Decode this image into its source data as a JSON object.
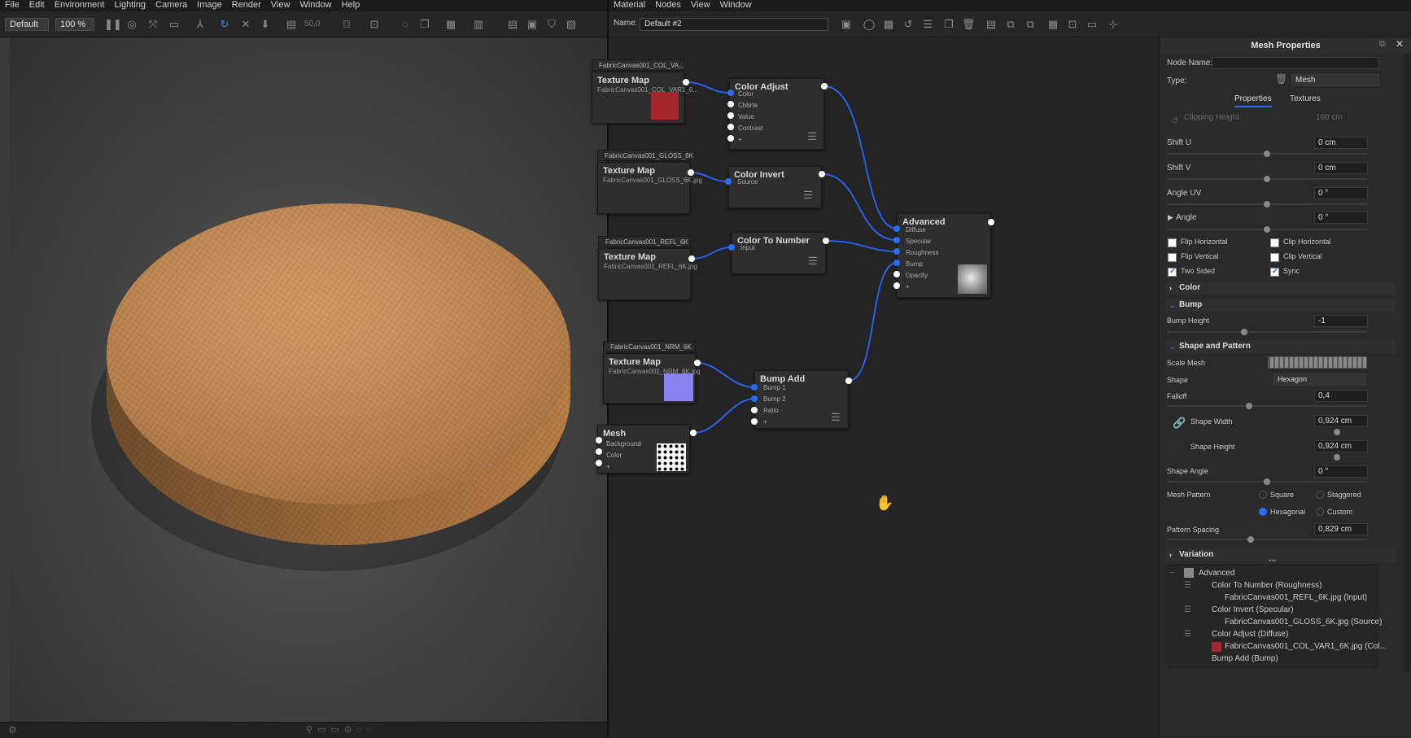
{
  "left_menu": [
    "File",
    "Edit",
    "Environment",
    "Lighting",
    "Camera",
    "Image",
    "Render",
    "View",
    "Window",
    "Help"
  ],
  "left_toolbar": {
    "preset": "Default",
    "zoom": "100 %",
    "resolution_value": "50,0"
  },
  "right_menu": [
    "Material",
    "Nodes",
    "View",
    "Window"
  ],
  "right_toolbar": {
    "name_label": "Name:",
    "name_value": "Default #2"
  },
  "nodes": {
    "col": {
      "header": "FabricCanvas001_COL_VA...",
      "title": "Texture Map",
      "file": "FabricCanvas001_COL_VAR1_6..."
    },
    "gloss": {
      "header": "FabricCanvas001_GLOSS_6K",
      "title": "Texture Map",
      "file": "FabricCanvas001_GLOSS_6K.jpg"
    },
    "refl": {
      "header": "FabricCanvas001_REFL_6K",
      "title": "Texture Map",
      "file": "FabricCanvas001_REFL_6K.jpg"
    },
    "nrm": {
      "header": "FabricCanvas001_NRM_6K",
      "title": "Texture Map",
      "file": "FabricCanvas001_NRM_6K.jpg"
    },
    "color_adjust": {
      "title": "Color Adjust",
      "ports": [
        "Color",
        "Cbbrte",
        "Value",
        "Contrast",
        "+"
      ]
    },
    "color_invert": {
      "title": "Color Invert",
      "ports": [
        "Source"
      ]
    },
    "color_to_number": {
      "title": "Color To Number",
      "ports": [
        "Input"
      ]
    },
    "advanced": {
      "title": "Advanced",
      "ports": [
        "Diffuse",
        "Specular",
        "Roughness",
        "Bump",
        "Opacity",
        "+"
      ]
    },
    "bump_add": {
      "title": "Bump Add",
      "ports": [
        "Bump 1",
        "Bump 2",
        "Ratio",
        "+"
      ]
    },
    "mesh": {
      "title": "Mesh",
      "ports": [
        "Background",
        "Color",
        "+"
      ]
    }
  },
  "properties": {
    "panel_title": "Mesh Properties",
    "node_name_label": "Node Name:",
    "type_label": "Type:",
    "type_value": "Mesh",
    "tabs": [
      "Properties",
      "Textures"
    ],
    "clipping_height_label": "Clipping Height",
    "clipping_height_value": "100 cm",
    "shift_u_label": "Shift U",
    "shift_u_value": "0 cm",
    "shift_v_label": "Shift V",
    "shift_v_value": "0 cm",
    "angle_uv_label": "Angle UV",
    "angle_uv_value": "0 °",
    "angle_label": "Angle",
    "angle_value": "0 °",
    "flip_horizontal": "Flip Horizontal",
    "clip_horizontal": "Clip Horizontal",
    "flip_vertical": "Flip Vertical",
    "clip_vertical": "Clip Vertical",
    "two_sided": "Two Sided",
    "sync": "Sync",
    "section_color": "Color",
    "section_bump": "Bump",
    "bump_height_label": "Bump Height",
    "bump_height_value": "-1",
    "section_shape": "Shape and Pattern",
    "scale_mesh_label": "Scale Mesh",
    "shape_label": "Shape",
    "shape_value": "Hexagon",
    "falloff_label": "Falloff",
    "falloff_value": "0,4",
    "shape_width_label": "Shape Width",
    "shape_width_value": "0,924 cm",
    "shape_height_label": "Shape Height",
    "shape_height_value": "0,924 cm",
    "shape_angle_label": "Shape Angle",
    "shape_angle_value": "0 °",
    "mesh_pattern_label": "Mesh Pattern",
    "pattern_square": "Square",
    "pattern_staggered": "Staggered",
    "pattern_hexagonal": "Hexagonal",
    "pattern_custom": "Custom",
    "pattern_spacing_label": "Pattern Spacing",
    "pattern_spacing_value": "0,829 cm",
    "section_variation": "Variation",
    "tree": [
      "Advanced",
      "Color To Number (Roughness)",
      "FabricCanvas001_REFL_6K.jpg (Input)",
      "Color Invert (Specular)",
      "FabricCanvas001_GLOSS_6K.jpg (Source)",
      "Color Adjust (Diffuse)",
      "FabricCanvas001_COL_VAR1_6K.jpg (Col...",
      "Bump Add (Bump)"
    ]
  },
  "colors": {
    "accent": "#2b6cf0",
    "wood": "#c98a4e",
    "col_swatch": "#a3272b",
    "nrm_swatch": "#8a82f0"
  }
}
